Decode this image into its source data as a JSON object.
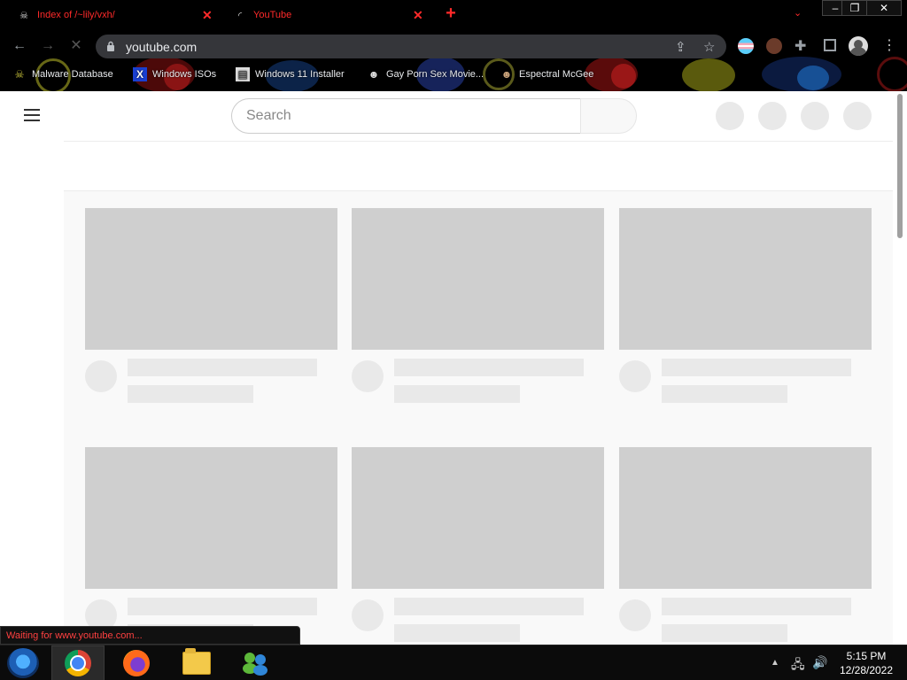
{
  "browser": {
    "tabs": [
      {
        "title": "Index of /~lily/vxh/",
        "close": "✕"
      },
      {
        "title": "YouTube",
        "close": "✕"
      }
    ],
    "new_tab": "+",
    "tab_search": "⌄",
    "window_controls": {
      "minimize": "–",
      "restore": "❐",
      "close": "✕"
    },
    "nav": {
      "back": "←",
      "forward": "→",
      "reload": "✕"
    },
    "address": "youtube.com",
    "bookmarks": [
      {
        "label": "Malware Database",
        "icon": "skull-icon"
      },
      {
        "label": "Windows ISOs",
        "icon": "x-logo-icon"
      },
      {
        "label": "Windows 11 Installer",
        "icon": "document-icon"
      },
      {
        "label": "Gay Porn Sex Movie...",
        "icon": "character-icon"
      },
      {
        "label": "Espectral McGee",
        "icon": "character-icon"
      }
    ],
    "status_text": "Waiting for www.youtube.com..."
  },
  "youtube": {
    "search_placeholder": "Search"
  },
  "taskbar": {
    "time": "5:15 PM",
    "date": "12/28/2022",
    "tray_up": "▲"
  },
  "colors": {
    "tab_text": "#ff2a2a",
    "skeleton_dark": "#cfcfcf",
    "skeleton_light": "#e9e9e9"
  }
}
